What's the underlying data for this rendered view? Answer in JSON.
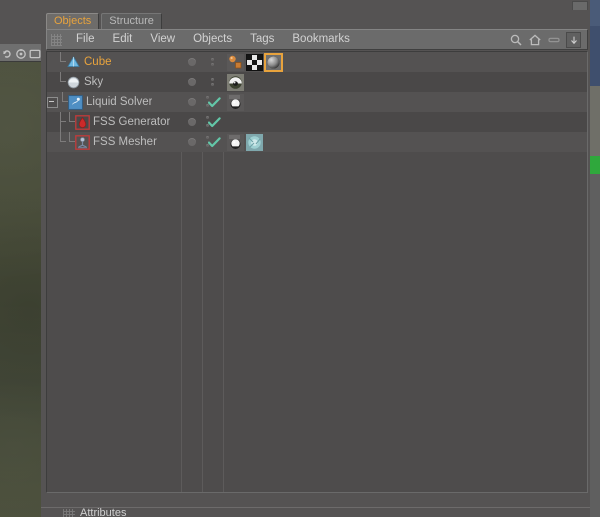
{
  "window": {
    "title": "Objects",
    "accent_color": "#e8a33d",
    "panel_bg": "#555353",
    "tree_bg": "#4e4c4c",
    "row_bg": "#545252",
    "row_alt_bg": "#4a4848",
    "check_color": "#63c7a8"
  },
  "tabs": [
    {
      "label": "Objects",
      "active": true
    },
    {
      "label": "Structure",
      "active": false
    }
  ],
  "menubar": {
    "grip_icon": "drag-grip-icon",
    "items": [
      {
        "label": "File"
      },
      {
        "label": "Edit"
      },
      {
        "label": "View"
      },
      {
        "label": "Objects"
      },
      {
        "label": "Tags"
      },
      {
        "label": "Bookmarks"
      }
    ],
    "right_icons": [
      {
        "name": "search-icon",
        "glyph": "search"
      },
      {
        "name": "home-icon",
        "glyph": "home"
      },
      {
        "name": "collapse-icon",
        "glyph": "minus-bar"
      },
      {
        "name": "expand-box-icon",
        "glyph": "arrow-box"
      }
    ]
  },
  "object_tree": {
    "columns": [
      "name",
      "visibility-editor",
      "visibility-render",
      "tags"
    ],
    "rows": [
      {
        "label": "Cube",
        "depth": 0,
        "selected": true,
        "icon": "cube-primitive-icon",
        "icon_color": "#6fb8e0",
        "expander": "none",
        "enabled_check": false,
        "tags": [
          {
            "name": "particle-tag",
            "kind": "particle",
            "selected": false
          },
          {
            "name": "texture-checker-tag",
            "kind": "checker",
            "selected": false
          },
          {
            "name": "material-tag",
            "kind": "material",
            "selected": true
          }
        ]
      },
      {
        "label": "Sky",
        "depth": 0,
        "selected": false,
        "icon": "sky-sphere-icon",
        "icon_color": "#cfd6dc",
        "expander": "none",
        "enabled_check": false,
        "tags": [
          {
            "name": "sky-material-tag",
            "kind": "skymaterial",
            "selected": false
          }
        ]
      },
      {
        "label": "Liquid Solver",
        "depth": 0,
        "selected": false,
        "icon": "liquid-solver-icon",
        "icon_color": "#4f8fc4",
        "expander": "expanded",
        "enabled_check": true,
        "tags": [
          {
            "name": "fluid-tag",
            "kind": "sphere",
            "selected": false
          }
        ]
      },
      {
        "label": "FSS Generator",
        "depth": 1,
        "selected": false,
        "icon": "fss-generator-icon",
        "icon_color": "#cc2a2a",
        "expander": "none",
        "enabled_check": true,
        "tags": []
      },
      {
        "label": "FSS Mesher",
        "depth": 1,
        "selected": false,
        "icon": "fss-mesher-icon",
        "icon_color": "#9ba6bd",
        "expander": "none",
        "enabled_check": true,
        "tags": [
          {
            "name": "fluid-tag",
            "kind": "sphere",
            "selected": false
          },
          {
            "name": "liquid-material-tag",
            "kind": "liquid",
            "selected": false
          }
        ]
      }
    ]
  },
  "bottom_panel": {
    "label": "Attributes",
    "grip_icon": "drag-grip-icon"
  },
  "left_toolbar": {
    "icons": [
      {
        "name": "undo-rotate-icon"
      },
      {
        "name": "axis-target-icon"
      },
      {
        "name": "render-view-icon"
      }
    ]
  }
}
